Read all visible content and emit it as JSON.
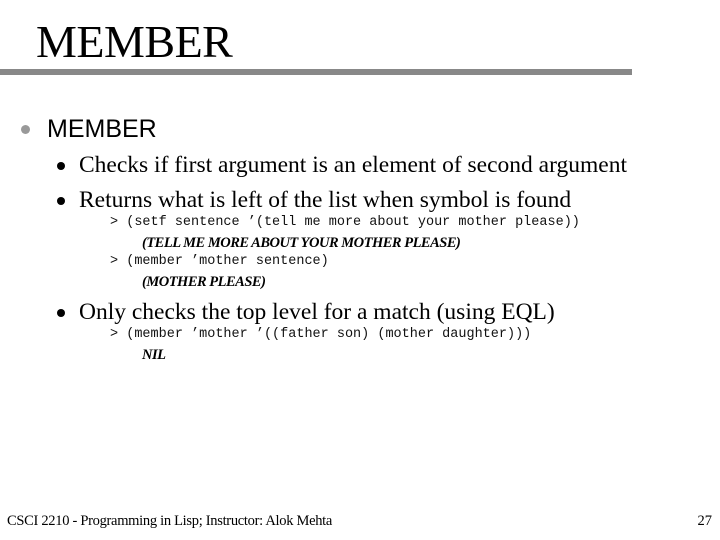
{
  "slide": {
    "title": "MEMBER",
    "bullets": [
      {
        "label": "MEMBER",
        "sub": [
          {
            "label": "Checks if first argument is an element of second argument"
          },
          {
            "label": "Returns what is left of the list when symbol is found",
            "examples": [
              {
                "prompt": ">",
                "code": "(setf sentence ’(tell me more about your mother please))",
                "result": "(TELL ME MORE ABOUT YOUR MOTHER PLEASE)"
              },
              {
                "prompt": ">",
                "code": "(member ’mother sentence)",
                "result": "(MOTHER PLEASE)"
              }
            ]
          },
          {
            "label": "Only checks the top level for a match (using EQL)",
            "examples": [
              {
                "prompt": ">",
                "code": "(member ’mother ’((father son) (mother daughter)))",
                "result": "NIL"
              }
            ]
          }
        ]
      }
    ]
  },
  "footer": {
    "course": "CSCI 2210 - Programming in Lisp; Instructor: Alok Mehta",
    "page_number": "27"
  },
  "colors": {
    "title_rule": "#888888",
    "level1_bullet": "#999999",
    "level2_bullet": "#000000"
  }
}
